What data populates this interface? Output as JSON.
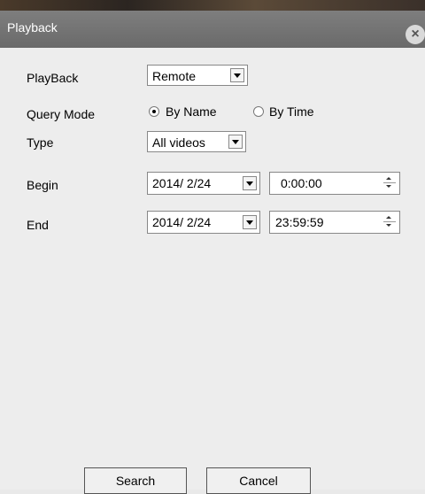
{
  "window": {
    "title": "Playback"
  },
  "form": {
    "playback": {
      "label": "PlayBack",
      "value": "Remote"
    },
    "query_mode": {
      "label": "Query Mode",
      "options": [
        "By Name",
        "By Time"
      ],
      "selected": "By Name"
    },
    "type": {
      "label": "Type",
      "value": "All videos"
    },
    "begin": {
      "label": "Begin",
      "date": "2014/ 2/24",
      "time": "0:00:00"
    },
    "end": {
      "label": "End",
      "date": "2014/ 2/24",
      "time": "23:59:59"
    }
  },
  "buttons": {
    "search": "Search",
    "cancel": "Cancel"
  },
  "icons": {
    "close": "close-icon",
    "dropdown": "chevron-down-icon",
    "spinner": "spinner-icon"
  }
}
